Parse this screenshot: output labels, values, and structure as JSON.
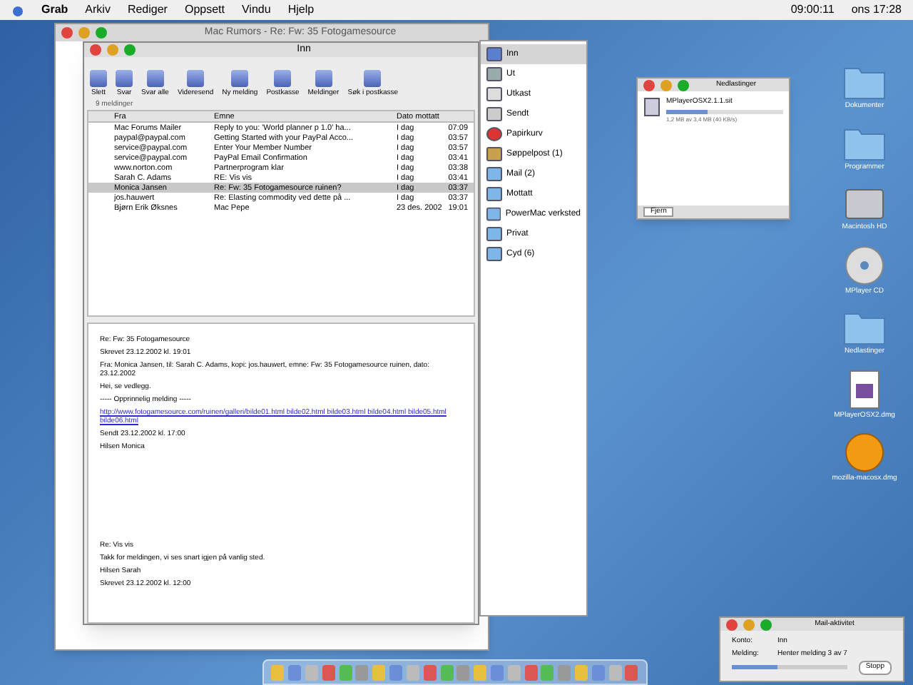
{
  "menu_bar": {
    "items": [
      {
        "label": "Grab",
        "selected": true
      },
      {
        "label": "Arkiv",
        "selected": false
      },
      {
        "label": "Rediger",
        "selected": false
      },
      {
        "label": "Oppsett",
        "selected": false
      },
      {
        "label": "Vindu",
        "selected": false
      },
      {
        "label": "Hjelp",
        "selected": false
      }
    ],
    "clock": "ons 17:28",
    "timer": "09:00:11"
  },
  "browser_window": {
    "title": "Mac Rumors - Re: Fw: 35 Fotogamesource"
  },
  "mail_window": {
    "title": "Inn",
    "toolbar": [
      "Slett",
      "Svar",
      "Svar alle",
      "Videresend",
      "Ny melding",
      "Postkasse",
      "Meldinger",
      "Søk i postkasse"
    ],
    "status": "9 meldinger",
    "columns": [
      "Fra",
      "Emne",
      "Dato mottatt"
    ],
    "rows": [
      {
        "from": "Mac Forums Mailer",
        "subject": "Reply to you: 'World planner p 1.0' ha...",
        "date": "I dag",
        "time": "07:09",
        "selected": false
      },
      {
        "from": "paypal@paypal.com",
        "subject": "Getting Started with your PayPal Acco...",
        "date": "I dag",
        "time": "03:57",
        "selected": false
      },
      {
        "from": "service@paypal.com",
        "subject": "Enter Your Member Number",
        "date": "I dag",
        "time": "03:57",
        "selected": false
      },
      {
        "from": "service@paypal.com",
        "subject": "PayPal Email Confirmation",
        "date": "I dag",
        "time": "03:41",
        "selected": false
      },
      {
        "from": "www.norton.com",
        "subject": "Partnerprogram klar",
        "date": "I dag",
        "time": "03:38",
        "selected": false
      },
      {
        "from": "Sarah C. Adams",
        "subject": "RE: Vis vis",
        "date": "I dag",
        "time": "03:41",
        "selected": false
      },
      {
        "from": "Monica Jansen",
        "subject": "Re: Fw: 35 Fotogamesource ruinen?",
        "date": "I dag",
        "time": "03:37",
        "selected": true
      },
      {
        "from": "jos.hauwert",
        "subject": "Re: Elasting commodity ved dette på ...",
        "date": "I dag",
        "time": "03:37",
        "selected": false
      },
      {
        "from": "Bjørn Erik Øksnes",
        "subject": "Mac Pepe",
        "date": "23 des. 2002",
        "time": "19:01",
        "selected": false
      }
    ],
    "body": [
      {
        "kind": "text",
        "text": "Re: Fw: 35 Fotogamesource"
      },
      {
        "kind": "text",
        "text": "Skrevet 23.12.2002 kl. 19:01"
      },
      {
        "kind": "text",
        "text": "Fra: Monica Jansen, til: Sarah C. Adams, kopi: jos.hauwert, emne: Fw: 35 Fotogamesource ruinen, dato: 23.12.2002"
      },
      {
        "kind": "text",
        "text": "Hei, se vedlegg."
      },
      {
        "kind": "text",
        "text": "----- Opprinnelig melding -----"
      },
      {
        "kind": "link",
        "text": "http://www.fotogamesource.com/ruinen/galleri/bilde01.html bilde02.html bilde03.html bilde04.html bilde05.html bilde06.html"
      },
      {
        "kind": "text",
        "text": "Sendt 23.12.2002 kl. 17:00"
      },
      {
        "kind": "text",
        "text": "Hilsen Monica"
      },
      {
        "kind": "text",
        "text": "Re: Vis vis"
      },
      {
        "kind": "text",
        "text": "Takk for meldingen, vi ses snart igjen på vanlig sted."
      },
      {
        "kind": "text",
        "text": "Hilsen Sarah"
      },
      {
        "kind": "text",
        "text": "Skrevet 23.12.2002 kl. 12:00"
      }
    ]
  },
  "mailbox_drawer": {
    "items": [
      {
        "label": "Inn",
        "kind": "inbox",
        "selected": true
      },
      {
        "label": "Ut",
        "kind": "outbox",
        "selected": false
      },
      {
        "label": "Utkast",
        "kind": "drafts",
        "selected": false
      },
      {
        "label": "Sendt",
        "kind": "sent",
        "selected": false
      },
      {
        "label": "Papirkurv",
        "kind": "trash",
        "selected": false
      },
      {
        "label": "Søppelpost (1)",
        "kind": "junk",
        "selected": false
      },
      {
        "label": "Mail (2)",
        "kind": "folder",
        "selected": false
      },
      {
        "label": "Mottatt",
        "kind": "folder",
        "selected": false
      },
      {
        "label": "PowerMac verksted",
        "kind": "folder",
        "selected": false
      },
      {
        "label": "Privat",
        "kind": "folder",
        "selected": false
      },
      {
        "label": "Cyd (6)",
        "kind": "folder",
        "selected": false
      }
    ]
  },
  "download_window": {
    "title": "Nedlastinger",
    "file": "MPlayerOSX2.1.1.sit",
    "detail": "1,2 MB av 3,4 MB (40 KB/s)",
    "level": 0.35,
    "button": "Fjern"
  },
  "desktop_icons": [
    {
      "label": "Dokumenter",
      "kind": "folder"
    },
    {
      "label": "Programmer",
      "kind": "folder"
    },
    {
      "label": "Macintosh HD",
      "kind": "disk"
    },
    {
      "label": "MPlayer CD",
      "kind": "cd"
    },
    {
      "label": "Nedlastinger",
      "kind": "folder"
    },
    {
      "label": "MPlayerOSX2.dmg",
      "kind": "document"
    },
    {
      "label": "mozilla-macosx.dmg",
      "kind": "app"
    }
  ],
  "activity_window": {
    "title": "Mail-aktivitet",
    "rows": [
      {
        "label": "Konto:",
        "value": "Inn"
      },
      {
        "label": "Melding:",
        "value": "Henter melding 3 av 7"
      }
    ],
    "level": 0.4,
    "button": "Stopp"
  }
}
